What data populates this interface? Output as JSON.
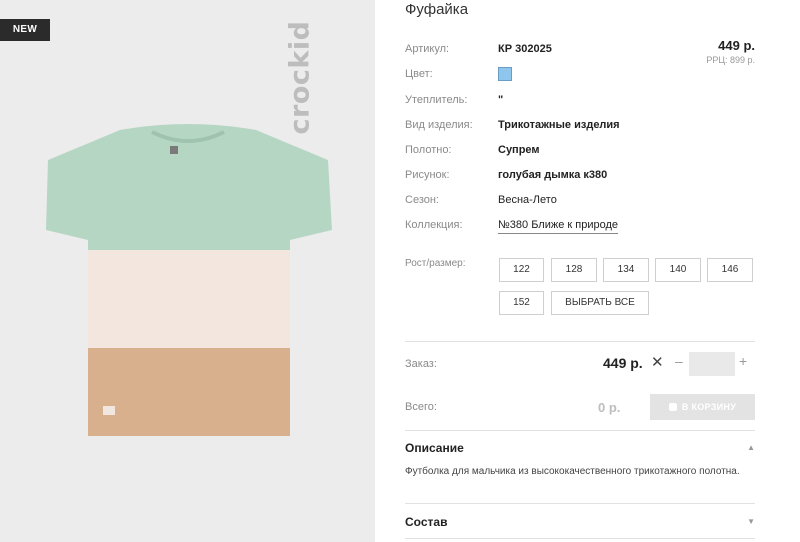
{
  "image": {
    "badge": "NEW",
    "brand_logo_text": "crockid",
    "shirt_colors": {
      "top": "#b6d6c4",
      "middle": "#f3e6de",
      "bottom": "#d8b08d"
    }
  },
  "product": {
    "title": "Фуфайка",
    "price": "449 р.",
    "rrp": "РРЦ: 899 р.",
    "attributes": {
      "article": {
        "label": "Артикул:",
        "value": "КР 302025"
      },
      "color": {
        "label": "Цвет:",
        "value": "#8fc6ee"
      },
      "insulation": {
        "label": "Утеплитель:",
        "value": "\""
      },
      "type": {
        "label": "Вид изделия:",
        "value": "Трикотажные изделия"
      },
      "fabric": {
        "label": "Полотно:",
        "value": "Супрем"
      },
      "print": {
        "label": "Рисунок:",
        "value": "голубая дымка к380"
      },
      "season": {
        "label": "Сезон:",
        "value": "Весна-Лето"
      },
      "collection": {
        "label": "Коллекция:",
        "value": "№380 Ближе к природе"
      }
    }
  },
  "sizes": {
    "label": "Рост/размер:",
    "items": [
      "122",
      "128",
      "134",
      "140",
      "146",
      "152"
    ],
    "select_all": "ВЫБРАТЬ ВСЕ"
  },
  "order": {
    "label": "Заказ:",
    "price": "449 р.",
    "quantity": ""
  },
  "total": {
    "label": "Всего:",
    "price": "0 р.",
    "cart_button": "В КОРЗИНУ"
  },
  "sections": {
    "description": {
      "title": "Описание",
      "text": "Футболка для мальчика из высококачественного трикотажного полотна."
    },
    "composition": {
      "title": "Состав"
    }
  }
}
